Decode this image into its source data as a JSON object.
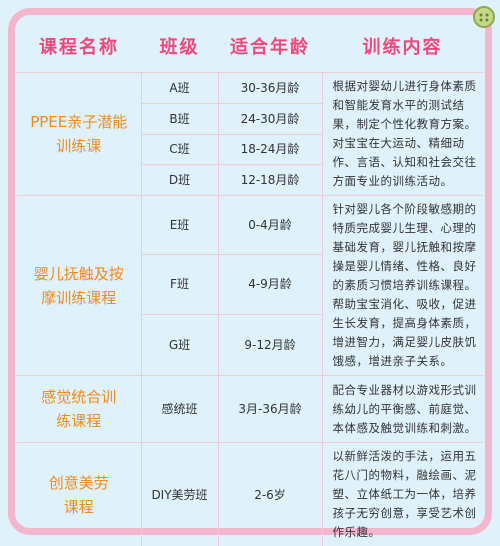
{
  "header": {
    "course": "课程名称",
    "class": "班级",
    "age": "适合年龄",
    "content": "训练内容"
  },
  "groups": [
    {
      "course": "PPEE亲子潜能训练课",
      "description": "根据对婴幼儿进行身体素质和智能发育水平的测试结果，制定个性化教育方案。对宝宝在大运动、精细动作、言语、认知和社会交往方面专业的训练活动。",
      "rows": [
        {
          "class": "A班",
          "age": "30-36月龄"
        },
        {
          "class": "B班",
          "age": "24-30月龄"
        },
        {
          "class": "C班",
          "age": "18-24月龄"
        },
        {
          "class": "D班",
          "age": "12-18月龄"
        }
      ]
    },
    {
      "course": "婴儿抚触及按摩训练课程",
      "description": "针对婴儿各个阶段敏感期的特质完成婴儿生理、心理的基础发育，婴儿抚触和按摩操是婴儿情绪、性格、良好的素质习惯培养训练课程。帮助宝宝消化、吸收，促进生长发育，提高身体素质，增进智力，满足婴儿皮肤饥饿感，增进亲子关系。",
      "rows": [
        {
          "class": "E班",
          "age": "0-4月龄"
        },
        {
          "class": "F班",
          "age": "4-9月龄"
        },
        {
          "class": "G班",
          "age": "9-12月龄"
        }
      ]
    },
    {
      "course": "感觉统合训练课程",
      "description": "配合专业器材以游戏形式训练幼儿的平衡感、前庭觉、本体感及触觉训练和刺激。",
      "rows": [
        {
          "class": "感统班",
          "age": "3月-36月龄"
        }
      ]
    },
    {
      "course": "创意美劳课程",
      "description": "以新鲜活泼的手法，运用五花八门的物料，融绘画、泥塑、立体纸工为一体，培养孩子无穷创意，享受艺术创作乐趣。",
      "rows": [
        {
          "class": "DIY美劳班",
          "age": "2-6岁"
        }
      ]
    }
  ],
  "colors": {
    "border": "#f4b6cc",
    "header_text": "#f0487a",
    "course_text": "#f08c1c",
    "background": "#dff1fb"
  }
}
